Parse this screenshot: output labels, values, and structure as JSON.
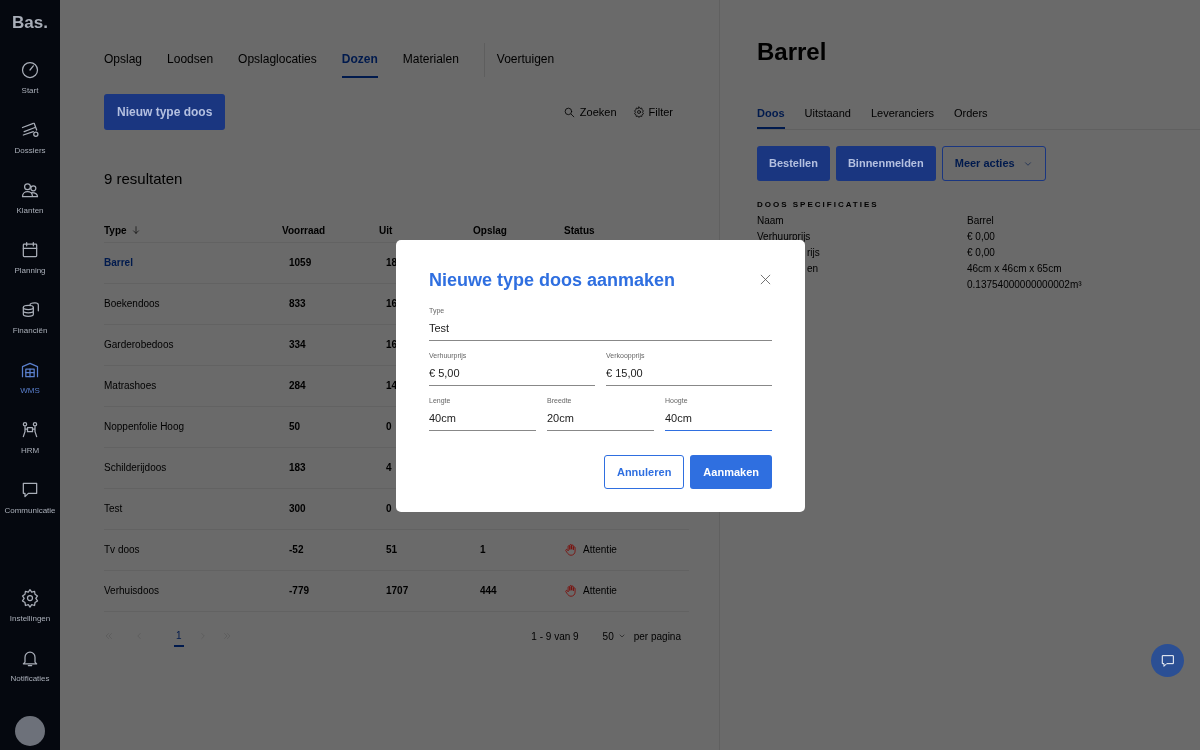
{
  "sidebar": {
    "logo": "Bas.",
    "items": [
      {
        "label": "Start",
        "selected": false
      },
      {
        "label": "Dossiers",
        "selected": false
      },
      {
        "label": "Klanten",
        "selected": false
      },
      {
        "label": "Planning",
        "selected": false
      },
      {
        "label": "Financiën",
        "selected": false
      },
      {
        "label": "WMS",
        "selected": true
      },
      {
        "label": "HRM",
        "selected": false
      },
      {
        "label": "Communicatie",
        "selected": false
      }
    ],
    "bottom_items": [
      {
        "label": "Instellingen"
      },
      {
        "label": "Notificaties"
      }
    ]
  },
  "tabs": [
    {
      "label": "Opslag",
      "selected": false
    },
    {
      "label": "Loodsen",
      "selected": false
    },
    {
      "label": "Opslaglocaties",
      "selected": false
    },
    {
      "label": "Dozen",
      "selected": true
    },
    {
      "label": "Materialen",
      "selected": false
    },
    {
      "label": "Voertuigen",
      "selected": false
    }
  ],
  "new_button": "Nieuw type doos",
  "search_label": "Zoeken",
  "filter_label": "Filter",
  "result_count": "9 resultaten",
  "table": {
    "columns": [
      "Type",
      "Voorraad",
      "Uit",
      "Opslag",
      "Status"
    ],
    "rows": [
      {
        "type": "Barrel",
        "selected": true,
        "voorraad": "1059",
        "uit": "18"
      },
      {
        "type": "Boekendoos",
        "selected": false,
        "voorraad": "833",
        "uit": "16"
      },
      {
        "type": "Garderobedoos",
        "selected": false,
        "voorraad": "334",
        "uit": "16"
      },
      {
        "type": "Matrashoes",
        "selected": false,
        "voorraad": "284",
        "uit": "14"
      },
      {
        "type": "Noppenfolie Hoog",
        "selected": false,
        "voorraad": "50",
        "uit": "0"
      },
      {
        "type": "Schilderijdoos",
        "selected": false,
        "voorraad": "183",
        "uit": "4"
      },
      {
        "type": "Test",
        "selected": false,
        "voorraad": "300",
        "uit": "0"
      },
      {
        "type": "Tv doos",
        "selected": false,
        "voorraad": "-52",
        "uit": "51",
        "opslag": "1",
        "status": {
          "kind": "attention",
          "label": "Attentie"
        }
      },
      {
        "type": "Verhuisdoos",
        "selected": false,
        "voorraad": "-779",
        "uit": "1707",
        "opslag": "444",
        "status": {
          "kind": "attention",
          "label": "Attentie"
        }
      }
    ]
  },
  "pagination": {
    "pages": [
      {
        "label": "1",
        "selected": true
      }
    ],
    "range": "1 - 9 van 9",
    "per_page": "50",
    "per_page_label": "per pagina"
  },
  "detail": {
    "title": "Barrel",
    "tabs": [
      {
        "label": "Doos",
        "selected": true
      },
      {
        "label": "Uitstaand",
        "selected": false
      },
      {
        "label": "Leveranciers",
        "selected": false
      },
      {
        "label": "Orders",
        "selected": false
      }
    ],
    "buttons": [
      {
        "label": "Bestellen",
        "kind": "primary"
      },
      {
        "label": "Binnenmelden",
        "kind": "primary"
      },
      {
        "label": "Meer acties",
        "kind": "dropdown"
      }
    ],
    "section_title": "DOOS SPECIFICATIES",
    "specs": [
      {
        "kind": "full",
        "label": "Naam",
        "value": "Barrel"
      },
      {
        "kind": "full",
        "label": "Verhuurprijs",
        "value": "€ 0,00"
      },
      {
        "kind": "cut",
        "label": "rijs",
        "value": "€ 0,00"
      },
      {
        "kind": "cut",
        "label": "en",
        "value": "46cm x 46cm x 65cm"
      },
      {
        "value": "0.13754000000000002m³"
      }
    ]
  },
  "modal": {
    "title": "Nieuwe type doos aanmaken",
    "fields": [
      [
        {
          "label": "Type",
          "value": "Test",
          "focused": false
        }
      ],
      [
        {
          "label": "Verhuurprijs",
          "value": "€ 5,00",
          "focused": false
        },
        {
          "label": "Verkoopprijs",
          "value": "€ 15,00",
          "focused": false
        }
      ],
      [
        {
          "label": "Lengte",
          "value": "40cm",
          "focused": false
        },
        {
          "label": "Breedte",
          "value": "20cm",
          "focused": false
        },
        {
          "label": "Hoogte",
          "value": "40cm",
          "focused": true
        }
      ]
    ],
    "cancel": "Annuleren",
    "submit": "Aanmaken"
  }
}
